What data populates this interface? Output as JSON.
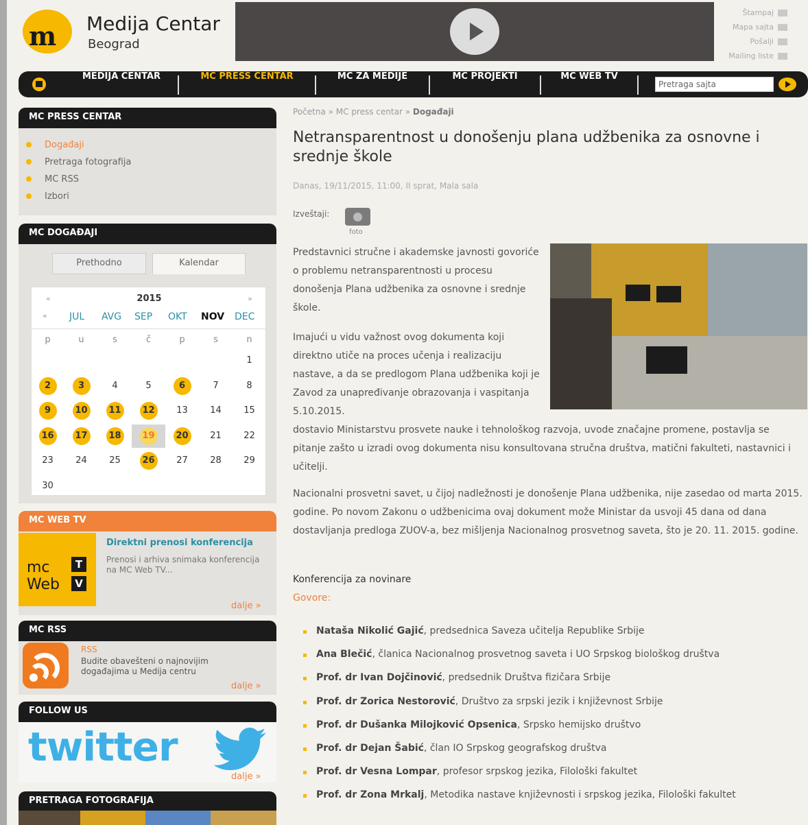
{
  "header": {
    "logo_mark": "m",
    "logo_title": "Medija Centar",
    "logo_subtitle": "Beograd",
    "top_links": [
      "Štampaj",
      "Mapa sajta",
      "Pošalji",
      "Mailing liste"
    ]
  },
  "nav": {
    "items": [
      "MEDIJA CENTAR",
      "MC PRESS CENTAR",
      "MC ZA MEDIJE",
      "MC PROJEKTI",
      "MC WEB TV"
    ],
    "active_index": 1,
    "search_value": "Pretraga sajta"
  },
  "sidebar": {
    "press_title": "MC PRESS CENTAR",
    "press_items": [
      "Događaji",
      "Pretraga fotografija",
      "MC RSS",
      "Izbori"
    ],
    "events_title": "MC DOGAĐAJI",
    "tab_prev": "Prethodno",
    "tab_calendar": "Kalendar",
    "calendar": {
      "prev": "«",
      "next": "»",
      "year": "2015",
      "months": [
        "JUL",
        "AVG",
        "SEP",
        "OKT",
        "NOV",
        "DEC"
      ],
      "current_month": "NOV",
      "weekdays": [
        "p",
        "u",
        "s",
        "č",
        "p",
        "s",
        "n"
      ],
      "days": [
        [
          "",
          "",
          "",
          "",
          "",
          "",
          "1"
        ],
        [
          "2",
          "3",
          "4",
          "5",
          "6",
          "7",
          "8"
        ],
        [
          "9",
          "10",
          "11",
          "12",
          "13",
          "14",
          "15"
        ],
        [
          "16",
          "17",
          "18",
          "19",
          "20",
          "21",
          "22"
        ],
        [
          "23",
          "24",
          "25",
          "26",
          "27",
          "28",
          "29"
        ],
        [
          "30",
          "",
          "",
          "",
          "",
          "",
          ""
        ]
      ],
      "event_days": [
        "2",
        "3",
        "6",
        "9",
        "10",
        "11",
        "12",
        "16",
        "17",
        "18",
        "19",
        "20",
        "26"
      ],
      "today": "19"
    },
    "webtv_title": "MC WEB TV",
    "webtv_link": "Direktni prenosi konferencija",
    "webtv_desc": "Prenosi i arhiva snimaka konferencija na MC Web TV...",
    "webtv_logo_top": "mc",
    "webtv_logo_bottom": "Web",
    "webtv_badge_t": "T",
    "webtv_badge_v": "V",
    "rss_title": "MC RSS",
    "rss_label": "RSS",
    "rss_desc": "Budite obavešteni o najnovijim događajima u Medija centru",
    "follow_title": "FOLLOW US",
    "twitter_word": "twitter",
    "photos_title": "PRETRAGA FOTOGRAFIJA",
    "more": "dalje »"
  },
  "article": {
    "breadcrumb": "Početna » MC press centar » ",
    "breadcrumb_current": "Događaji",
    "title": "Netransparentnost u donošenju plana udžbenika za osnovne i srednje škole",
    "meta": "Danas, 19/11/2015, 11:00, II sprat, Mala sala",
    "reports_label": "Izveštaji:",
    "foto_label": "foto",
    "p1": "Predstavnici stručne i akademske javnosti govoriće o problemu netransparentnosti u procesu donošenja Plana udžbenika za osnovne i srednje škole.",
    "p2a": "Imajući u vidu važnost ovog dokumenta koji direktno utiče na proces učenja i realizaciju nastave, a da se predlogom Plana udžbenika koji je Zavod za unapređivanje obrazovanja i vaspitanja 5.10.2015.",
    "p2b": "dostavio Ministarstvu prosvete nauke i tehnološkog razvoja, uvode značajne promene, postavlja se pitanje zašto u izradi ovog dokumenta nisu konsultovana stručna društva, matični fakulteti, nastavnici i učitelji.",
    "p3": "Nacionalni prosvetni savet, u čijoj nadležnosti je donošenje Plana udžbenika, nije zasedao od marta 2015. godine. Po novom Zakonu o udžbenicima ovaj dokument može Ministar da usvoji 45 dana od dana dostavljanja predloga ZUOV-a, bez mišljenja Nacionalnog prosvetnog saveta, što je 20. 11. 2015. godine.",
    "conference": "Konferencija za novinare",
    "speakers_label": "Govore:",
    "speakers": [
      {
        "name": "Nataša Nikolić Gajić",
        "role": ", predsednica Saveza učitelja Republike Srbije"
      },
      {
        "name": "Ana Blečić",
        "role": ", članica Nacionalnog prosvetnog saveta i UO Srpskog biološkog društva"
      },
      {
        "name": "Prof. dr Ivan Dojčinović",
        "role": ", predsednik Društva fizičara Srbije"
      },
      {
        "name": "Prof. dr Zorica Nestorović",
        "role": ", Društvo za srpski jezik i književnost Srbije"
      },
      {
        "name": "Prof. dr Dušanka Milojković Opsenica",
        "role": ", Srpsko hemijsko društvo"
      },
      {
        "name": "Prof. dr Dejan Šabić",
        "role": ", član IO Srpskog geografskog društva"
      },
      {
        "name": "Prof. dr Vesna Lompar",
        "role": ", profesor srpskog jezika, Filološki fakultet"
      },
      {
        "name": "Prof. dr Zona Mrkalj",
        "role": ", Metodika nastave književnosti i srpskog jezika, Filološki fakultet"
      }
    ]
  },
  "colors": {
    "accent": "#f6b800",
    "orange": "#f0823b",
    "dark": "#1b1b1b",
    "twitter": "#3eb0e6"
  }
}
